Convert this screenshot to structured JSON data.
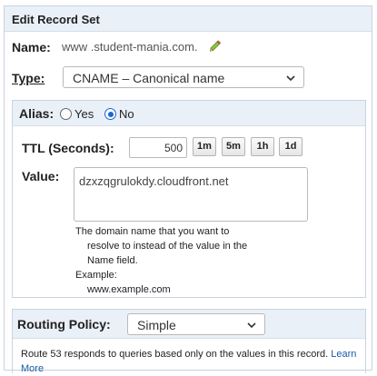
{
  "panel": {
    "title": "Edit Record Set"
  },
  "name": {
    "label": "Name:",
    "value": "www .student-mania.com."
  },
  "type": {
    "label": "Type:",
    "selected": "CNAME – Canonical name"
  },
  "alias": {
    "label": "Alias:",
    "yes_label": "Yes",
    "no_label": "No",
    "selected": "No"
  },
  "ttl": {
    "label": "TTL (Seconds):",
    "value": "500",
    "buttons": [
      "1m",
      "5m",
      "1h",
      "1d"
    ]
  },
  "value": {
    "label": "Value:",
    "text": "dzxzqgrulokdy.cloudfront.net",
    "help_lines": [
      "The domain name that you want to",
      "resolve to instead of the value in the",
      "Name field.",
      "Example:",
      "www.example.com"
    ]
  },
  "routing": {
    "label": "Routing Policy:",
    "selected": "Simple",
    "description": "Route 53 responds to queries based only on the values in this record.",
    "learn_more": "Learn",
    "learn_more_2": "More"
  },
  "colors": {
    "header_bg": "#eaf0f8",
    "accent": "#1a66d2",
    "link": "#1a5aa8"
  },
  "icons": [
    "pencil-icon",
    "chevron-down-icon"
  ]
}
